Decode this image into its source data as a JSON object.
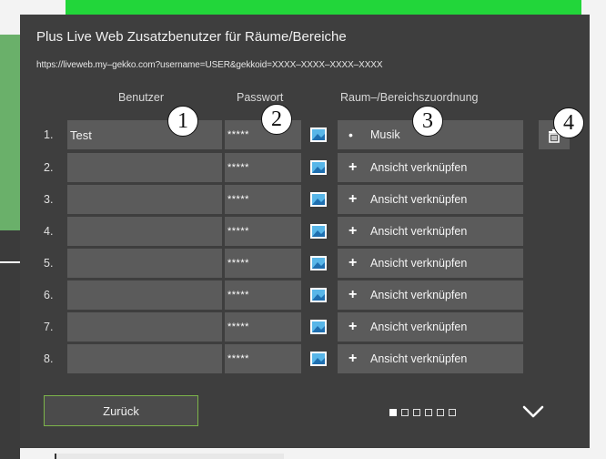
{
  "dialog": {
    "title": "Plus Live Web Zusatzbenutzer für Räume/Bereiche",
    "url": "https://liveweb.my–gekko.com?username=USER&gekkoid=XXXX–XXXX–XXXX–XXXX"
  },
  "columns": {
    "benutzer": "Benutzer",
    "passwort": "Passwort",
    "raum": "Raum–/Bereichszuordnung"
  },
  "rows": [
    {
      "num": "1.",
      "user": "Test",
      "password": "*****",
      "assign_symbol": "•",
      "assign_label": "Musik"
    },
    {
      "num": "2.",
      "user": "",
      "password": "*****",
      "assign_symbol": "+",
      "assign_label": "Ansicht verknüpfen"
    },
    {
      "num": "3.",
      "user": "",
      "password": "*****",
      "assign_symbol": "+",
      "assign_label": "Ansicht verknüpfen"
    },
    {
      "num": "4.",
      "user": "",
      "password": "*****",
      "assign_symbol": "+",
      "assign_label": "Ansicht verknüpfen"
    },
    {
      "num": "5.",
      "user": "",
      "password": "*****",
      "assign_symbol": "+",
      "assign_label": "Ansicht verknüpfen"
    },
    {
      "num": "6.",
      "user": "",
      "password": "*****",
      "assign_symbol": "+",
      "assign_label": "Ansicht verknüpfen"
    },
    {
      "num": "7.",
      "user": "",
      "password": "*****",
      "assign_symbol": "+",
      "assign_label": "Ansicht verknüpfen"
    },
    {
      "num": "8.",
      "user": "",
      "password": "*****",
      "assign_symbol": "+",
      "assign_label": "Ansicht verknüpfen"
    }
  ],
  "callouts": [
    "1",
    "2",
    "3",
    "4"
  ],
  "footer": {
    "back_label": "Zurück",
    "pages_total": 6,
    "page_current": 1
  },
  "icons": {
    "password_icon": "image-icon",
    "delete": "trash-icon",
    "next": "chevron-down-icon"
  },
  "colors": {
    "modal_bg": "#3e3e3e",
    "field_bg": "#5b5b5b",
    "accent_green": "#7db54a",
    "header_green": "#22d63a"
  }
}
